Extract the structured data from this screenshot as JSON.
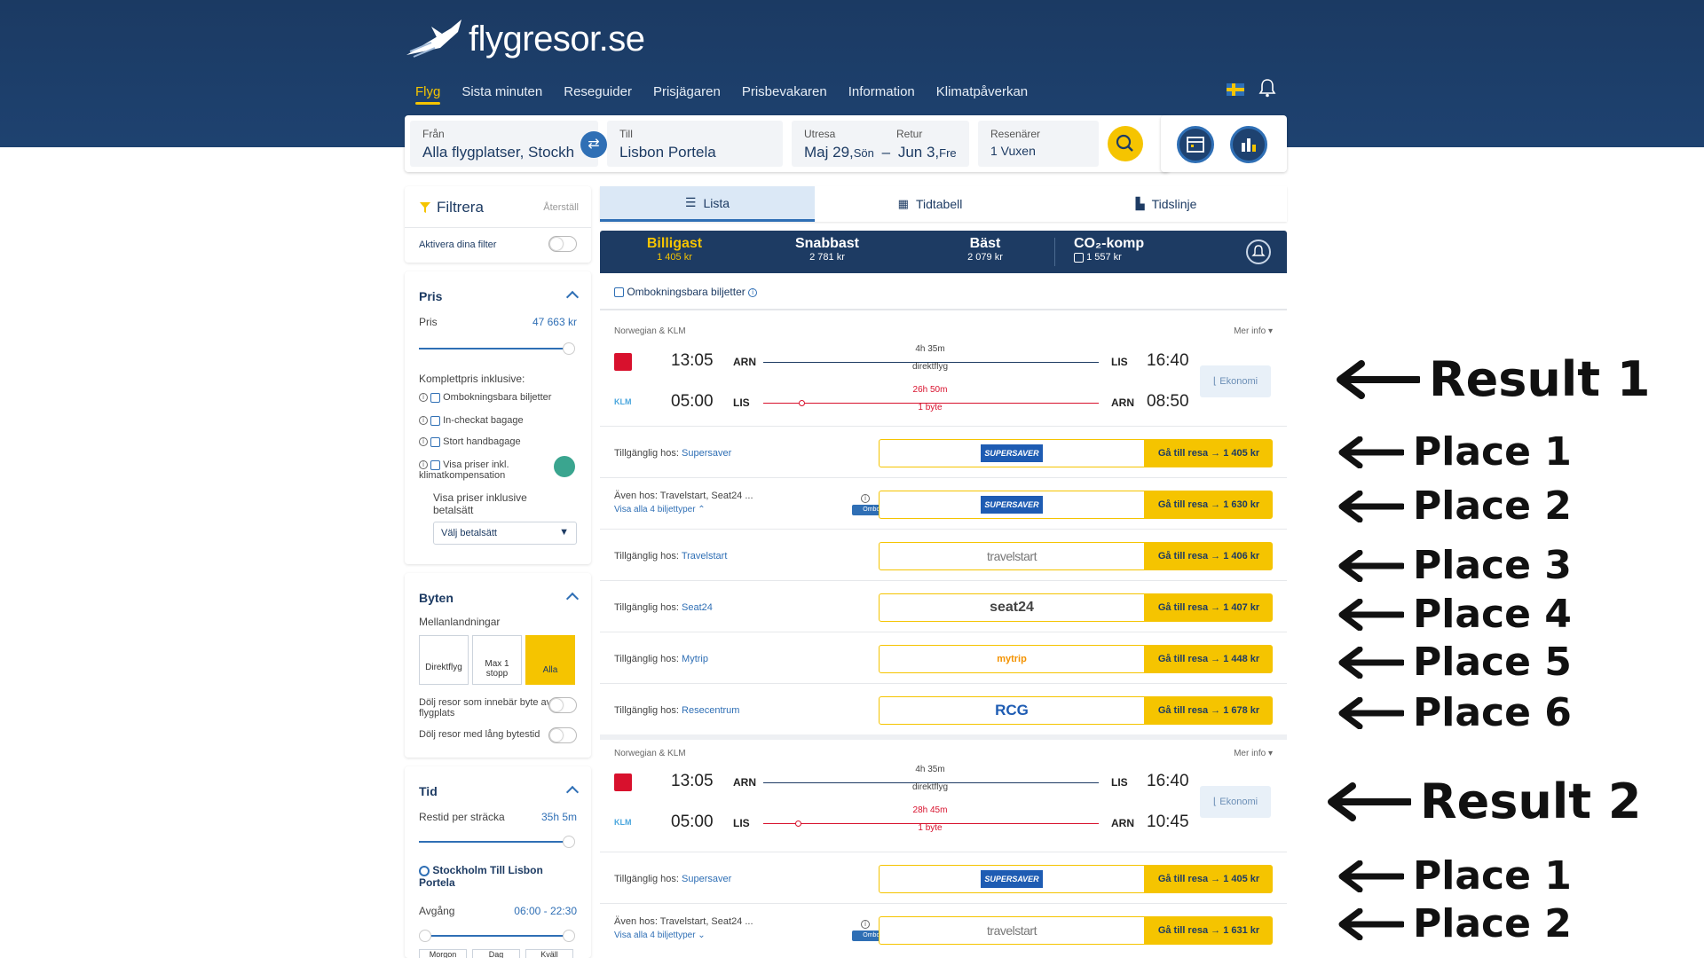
{
  "brand": {
    "logo_text": "flygresor.se"
  },
  "nav": {
    "items": [
      "Flyg",
      "Sista minuten",
      "Reseguider",
      "Prisjägaren",
      "Prisbevakaren",
      "Information",
      "Klimatpåverkan"
    ]
  },
  "search": {
    "from_label": "Från",
    "from_value": "Alla flygplatser, Stockh",
    "to_label": "Till",
    "to_value": "Lisbon Portela",
    "depart_label": "Utresa",
    "depart_date": "Maj 29,",
    "depart_day": "Sön",
    "return_label": "Retur",
    "return_date": "Jun 3,",
    "return_day": "Fre",
    "sep": "–",
    "travelers_label": "Resenärer",
    "travelers_value": "1 Vuxen"
  },
  "filters": {
    "title": "Filtrera",
    "reset": "Återställ",
    "activate": "Aktivera dina filter",
    "price_section": "Pris",
    "price_label": "Pris",
    "price_value": "47 663 kr",
    "complete_price": "Komplettpris inklusive:",
    "options": [
      "Ombokningsbara biljetter",
      "In-checkat bagage",
      "Stort handbagage",
      "Visa priser inkl. klimatkompensation"
    ],
    "payment_text": "Visa priser inklusive betalsätt",
    "payment_select": "Välj betalsätt",
    "stops_section": "Byten",
    "stopovers": "Mellanlandningar",
    "stop_buttons": [
      "Direktflyg",
      "Max 1 stopp",
      "Alla"
    ],
    "hide_airport_change": "Dölj resor som innebär byte av flygplats",
    "hide_long_layover": "Dölj resor med lång bytestid",
    "time_section": "Tid",
    "travel_time_label": "Restid per sträcka",
    "travel_time_value": "35h 5m",
    "route_title": "Stockholm Till Lisbon Portela",
    "departure_label": "Avgång",
    "departure_range": "06:00 - 22:30",
    "day_buttons": [
      "Morgon",
      "Dag",
      "Kväll"
    ]
  },
  "tabs": [
    "Lista",
    "Tidtabell",
    "Tidslinje"
  ],
  "sort": [
    {
      "title": "Billigast",
      "price": "1 405 kr"
    },
    {
      "title": "Snabbast",
      "price": "2 781 kr"
    },
    {
      "title": "Bäst",
      "price": "2 079 kr"
    },
    {
      "title": "CO₂-komp",
      "price": "1 557 kr"
    }
  ],
  "rebookable": "Ombokningsbara biljetter",
  "results": [
    {
      "airline": "Norwegian & KLM",
      "more": "Mer info ▾",
      "cabin": "Ekonomi",
      "out": {
        "dep": "13:05",
        "from": "ARN",
        "dur": "4h 35m",
        "stops": "direktflyg",
        "to": "LIS",
        "arr": "16:40"
      },
      "ret": {
        "dep": "05:00",
        "from": "LIS",
        "dur": "26h 50m",
        "stops": "1 byte",
        "to": "ARN",
        "arr": "08:50"
      },
      "offers": [
        {
          "avail": "Tillgänglig hos:",
          "provider": "Supersaver",
          "badge": "SUPERSAVER",
          "cta": "Gå till resa →",
          "price": "1 405 kr"
        },
        {
          "avail": "Även hos: Travelstart, Seat24 ...",
          "sub": "Visa alla 4 biljettyper ⌃",
          "provider": "",
          "badge": "SUPERSAVER",
          "ombok": "Ombokningsbar",
          "cta": "Gå till resa →",
          "price": "1 630 kr"
        },
        {
          "avail": "Tillgänglig hos:",
          "provider": "Travelstart",
          "badge": "travelstart",
          "cta": "Gå till resa →",
          "price": "1 406 kr"
        },
        {
          "avail": "Tillgänglig hos:",
          "provider": "Seat24",
          "badge": "seat24",
          "cta": "Gå till resa →",
          "price": "1 407 kr"
        },
        {
          "avail": "Tillgänglig hos:",
          "provider": "Mytrip",
          "badge": "mytrip",
          "cta": "Gå till resa →",
          "price": "1 448 kr"
        },
        {
          "avail": "Tillgänglig hos:",
          "provider": "Resecentrum",
          "badge": "RCG",
          "cta": "Gå till resa →",
          "price": "1 678 kr"
        }
      ]
    },
    {
      "airline": "Norwegian & KLM",
      "more": "Mer info ▾",
      "cabin": "Ekonomi",
      "out": {
        "dep": "13:05",
        "from": "ARN",
        "dur": "4h 35m",
        "stops": "direktflyg",
        "to": "LIS",
        "arr": "16:40"
      },
      "ret": {
        "dep": "05:00",
        "from": "LIS",
        "dur": "28h 45m",
        "stops": "1 byte",
        "to": "ARN",
        "arr": "10:45"
      },
      "offers": [
        {
          "avail": "Tillgänglig hos:",
          "provider": "Supersaver",
          "badge": "SUPERSAVER",
          "cta": "Gå till resa →",
          "price": "1 405 kr"
        },
        {
          "avail": "Även hos: Travelstart, Seat24 ...",
          "sub": "Visa alla 4 biljettyper ⌄",
          "provider": "",
          "badge": "travelstart",
          "ombok": "Ombokningsbar",
          "cta": "Gå till resa →",
          "price": "1 631 kr"
        }
      ]
    }
  ],
  "annotations": [
    "Result 1",
    "Place 1",
    "Place 2",
    "Place 3",
    "Place 4",
    "Place 5",
    "Place 6",
    "Result 2",
    "Place 1",
    "Place 2"
  ],
  "colors": {
    "navy": "#1d3b63",
    "accent": "#f5c400",
    "blue": "#2f6fb5",
    "red_line": "#d8112d"
  }
}
